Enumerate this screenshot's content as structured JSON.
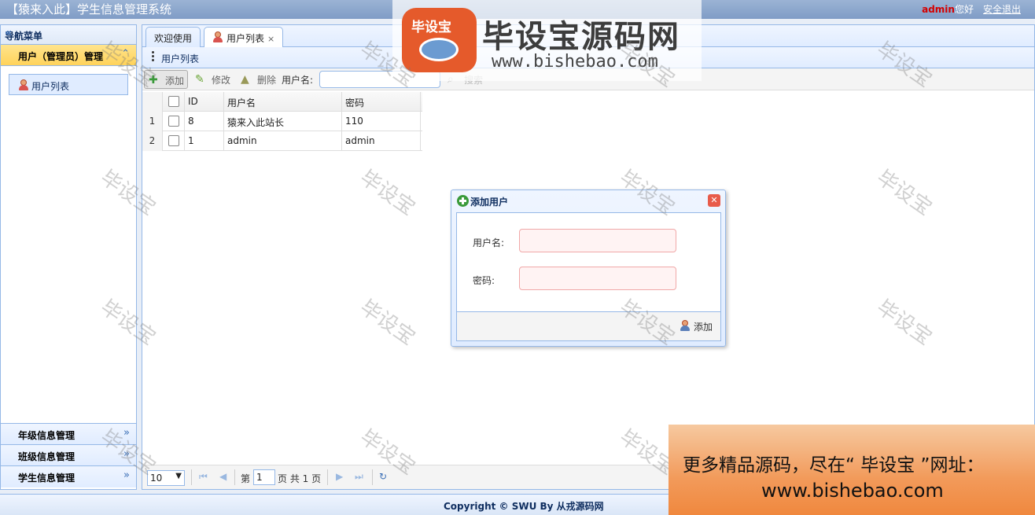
{
  "header": {
    "title": "【猿来入此】学生信息管理系统",
    "username": "admin",
    "greeting": "您好",
    "logout": "安全退出"
  },
  "nav": {
    "title": "导航菜单",
    "sections": [
      {
        "label": "用户（管理员）管理",
        "active": true,
        "items": [
          {
            "label": "用户列表"
          }
        ]
      },
      {
        "label": "年级信息管理"
      },
      {
        "label": "班级信息管理"
      },
      {
        "label": "学生信息管理"
      }
    ]
  },
  "tabs": [
    {
      "label": "欢迎使用"
    },
    {
      "label": "用户列表",
      "closable": true
    }
  ],
  "panel": {
    "title": "用户列表",
    "toolbar": {
      "add": "添加",
      "edit": "修改",
      "delete": "删除",
      "username_label": "用户名:",
      "search": "搜索"
    }
  },
  "grid": {
    "columns": [
      "ID",
      "用户名",
      "密码"
    ],
    "rows": [
      {
        "rownum": "1",
        "id": "8",
        "username": "猿来入此站长",
        "password": "110"
      },
      {
        "rownum": "2",
        "id": "1",
        "username": "admin",
        "password": "admin"
      }
    ]
  },
  "pager": {
    "page_size": "10",
    "page_prefix": "第",
    "page": "1",
    "page_suffix": "页 共 1 页"
  },
  "dialog": {
    "title": "添加用户",
    "username_label": "用户名:",
    "password_label": "密码:",
    "submit": "添加"
  },
  "footer": {
    "copyright": "Copyright © SWU By 从戎源码网"
  },
  "watermark": {
    "brand": "毕设宝",
    "site_title": "毕设宝源码网",
    "site_url": "www.bishebao.com",
    "promo_line1": "更多精品源码，尽在“ 毕设宝 ”网址：",
    "promo_line2": "www.bishebao.com"
  }
}
